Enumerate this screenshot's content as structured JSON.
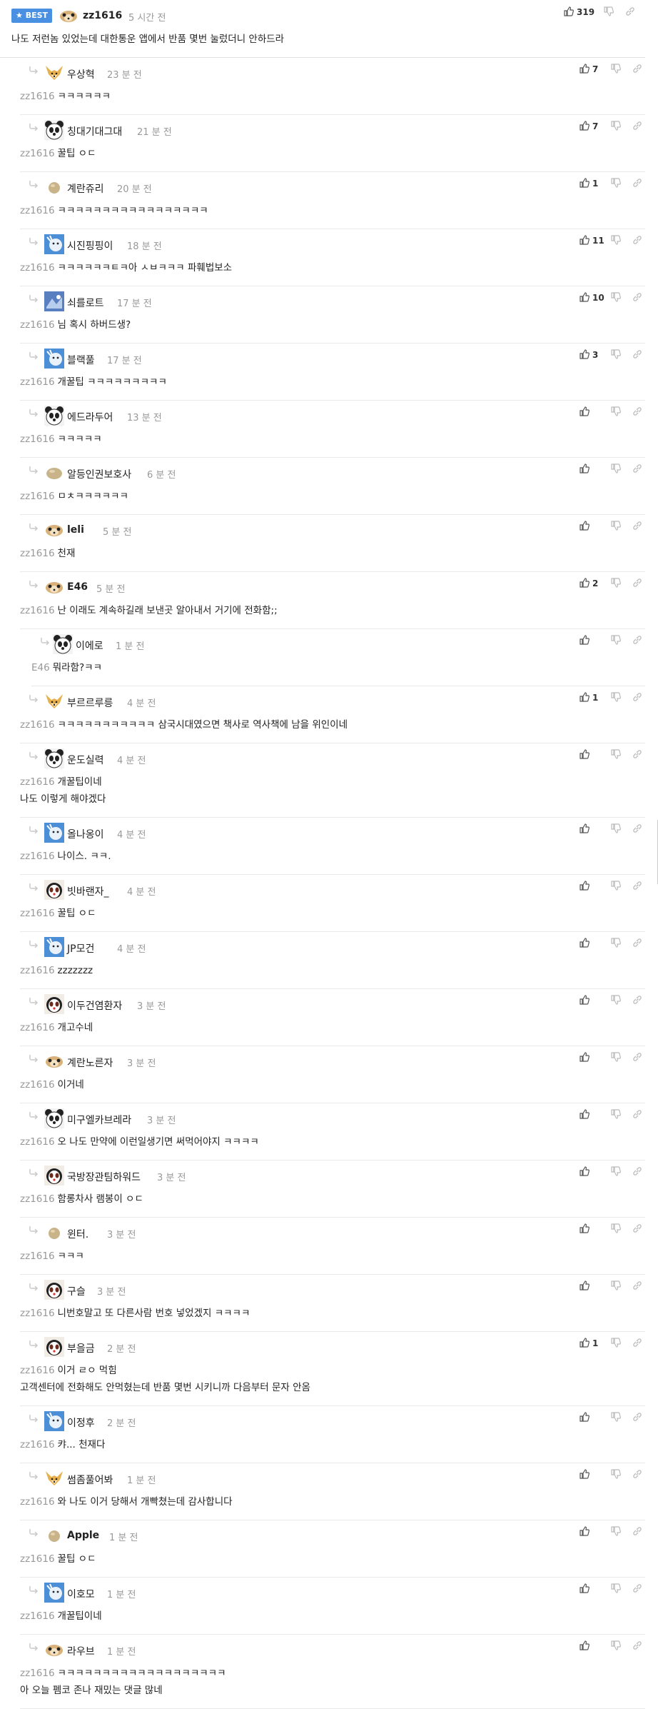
{
  "best": {
    "badge": "★ BEST",
    "nick": "zz1616",
    "time": "5 시간 전",
    "likes": "319",
    "text": "나도 저런놈 있었는데 대한통운 앱에서 반품 몇번 눌렀더니 안하드라"
  },
  "comments": [
    {
      "nick": "우상혁",
      "time": "23 분 전",
      "mention": "zz1616",
      "lines": [
        "ㅋㅋㅋㅋㅋㅋ"
      ],
      "likes": "7",
      "avatar": "fennec"
    },
    {
      "nick": "칭대기대그대",
      "time": "21 분 전",
      "mention": "zz1616",
      "lines": [
        "꿀팁 ㅇㄷ"
      ],
      "likes": "7",
      "avatar": "panda"
    },
    {
      "nick": "계란쥬리",
      "time": "20 분 전",
      "mention": "zz1616",
      "lines": [
        "ㅋㅋㅋㅋㅋㅋㅋㅋㅋㅋㅋㅋㅋㅋㅋㅋㅋ"
      ],
      "likes": "1",
      "avatar": "egg"
    },
    {
      "nick": "시진핑핑이",
      "time": "18 분 전",
      "mention": "zz1616",
      "lines": [
        "ㅋㅋㅋㅋㅋㅋㅌㅋ아 ㅅㅂㅋㅋㅋ 파훼법보소"
      ],
      "likes": "11",
      "avatar": "blue"
    },
    {
      "nick": "쇠를로트",
      "time": "17 분 전",
      "mention": "zz1616",
      "lines": [
        "님 혹시 하버드생?"
      ],
      "likes": "10",
      "avatar": "blue2"
    },
    {
      "nick": "블랙풀",
      "time": "17 분 전",
      "mention": "zz1616",
      "lines": [
        "개꿀팁 ㅋㅋㅋㅋㅋㅋㅋㅋㅋ"
      ],
      "likes": "3",
      "avatar": "blue"
    },
    {
      "nick": "에드라두어",
      "time": "13 분 전",
      "mention": "zz1616",
      "lines": [
        "ㅋㅋㅋㅋㅋ"
      ],
      "likes": "",
      "avatar": "panda"
    },
    {
      "nick": "알등인권보호사",
      "time": "6 분 전",
      "mention": "zz1616",
      "lines": [
        "ㅁㅊㅋㅋㅋㅋㅋㅋ"
      ],
      "likes": "",
      "avatar": "eggbig"
    },
    {
      "nick": "leli",
      "time": "5 분 전",
      "mention": "zz1616",
      "lines": [
        "천재"
      ],
      "likes": "",
      "avatar": "meerkat",
      "bold": true
    },
    {
      "nick": "E46",
      "time": "5 분 전",
      "mention": "zz1616",
      "lines": [
        "난 이래도 계속하길래 보낸곳 알아내서 거기에 전화함;;"
      ],
      "likes": "2",
      "avatar": "meerkat",
      "bold": true
    },
    {
      "nick": "이에로",
      "time": "1 분 전",
      "mention": "E46",
      "lines": [
        "뭐라함?ㅋㅋ"
      ],
      "likes": "",
      "avatar": "panda",
      "child": true
    },
    {
      "nick": "부르르루릉",
      "time": "4 분 전",
      "mention": "zz1616",
      "lines": [
        "ㅋㅋㅋㅋㅋㅋㅋㅋㅋㅋㅋ 삼국시대였으면 책사로 역사책에 남을 위인이네"
      ],
      "likes": "1",
      "avatar": "fennec"
    },
    {
      "nick": "운도실력",
      "time": "4 분 전",
      "mention": "zz1616",
      "lines": [
        "개꿀팁이네",
        "나도 이렇게 해야겠다"
      ],
      "likes": "",
      "avatar": "panda"
    },
    {
      "nick": "올나옹이",
      "time": "4 분 전",
      "mention": "zz1616",
      "lines": [
        "나이스. ㅋㅋ."
      ],
      "likes": "",
      "avatar": "blue"
    },
    {
      "nick": "빗바랜자_",
      "time": "4 분 전",
      "mention": "zz1616",
      "lines": [
        "꿀팁 ㅇㄷ"
      ],
      "likes": "",
      "avatar": "redpanda"
    },
    {
      "nick": "JP모건",
      "time": "4 분 전",
      "mention": "zz1616",
      "lines": [
        "zzzzzzz"
      ],
      "likes": "",
      "avatar": "blue"
    },
    {
      "nick": "이두건염환자",
      "time": "3 분 전",
      "mention": "zz1616",
      "lines": [
        "개고수네"
      ],
      "likes": "",
      "avatar": "redpanda"
    },
    {
      "nick": "계란노른자",
      "time": "3 분 전",
      "mention": "zz1616",
      "lines": [
        "이거네"
      ],
      "likes": "",
      "avatar": "meerkat"
    },
    {
      "nick": "미구엘카브레라",
      "time": "3 분 전",
      "mention": "zz1616",
      "lines": [
        "오 나도 만약에 이런일생기면 써먹어야지 ㅋㅋㅋㅋ"
      ],
      "likes": "",
      "avatar": "panda"
    },
    {
      "nick": "국방장관팀하워드",
      "time": "3 분 전",
      "mention": "zz1616",
      "lines": [
        "함롱차사 램봉이 ㅇㄷ"
      ],
      "likes": "",
      "avatar": "redpanda"
    },
    {
      "nick": "윈터.",
      "time": "3 분 전",
      "mention": "zz1616",
      "lines": [
        "ㅋㅋㅋ"
      ],
      "likes": "",
      "avatar": "egg"
    },
    {
      "nick": "구슬",
      "time": "3 분 전",
      "mention": "zz1616",
      "lines": [
        "니번호말고 또 다른사람 번호 넣었겠지 ㅋㅋㅋㅋ"
      ],
      "likes": "",
      "avatar": "redpanda"
    },
    {
      "nick": "부을금",
      "time": "2 분 전",
      "mention": "zz1616",
      "lines": [
        "이거 ㄹㅇ 먹힘",
        "고객센터에 전화해도 안먹혔는데 반품 몇번 시키니까 다음부터 문자 안옴"
      ],
      "likes": "1",
      "avatar": "redpanda"
    },
    {
      "nick": "이정후",
      "time": "2 분 전",
      "mention": "zz1616",
      "lines": [
        "캬... 천재다"
      ],
      "likes": "",
      "avatar": "blue"
    },
    {
      "nick": "썸좀풀어봐",
      "time": "1 분 전",
      "mention": "zz1616",
      "lines": [
        "와 나도 이거 당해서 개빡쳤는데 감사합니다"
      ],
      "likes": "",
      "avatar": "fennec"
    },
    {
      "nick": "Apple",
      "time": "1 분 전",
      "mention": "zz1616",
      "lines": [
        "꿀팁 ㅇㄷ"
      ],
      "likes": "",
      "avatar": "egg",
      "bold": true
    },
    {
      "nick": "이호모",
      "time": "1 분 전",
      "mention": "zz1616",
      "lines": [
        "개꿀팁이네"
      ],
      "likes": "",
      "avatar": "blue"
    },
    {
      "nick": "라우브",
      "time": "1 분 전",
      "mention": "zz1616",
      "lines": [
        "ㅋㅋㅋㅋㅋㅋㅋㅋㅋㅋㅋㅋㅋㅋㅋㅋㅋㅋㅋ",
        "아 오늘 펨코 존나 재밌는 댓글 많네"
      ],
      "likes": "",
      "avatar": "meerkat"
    }
  ],
  "icons": {
    "like": "thumbs-up-icon",
    "dislike": "thumbs-down-icon",
    "link": "link-icon",
    "reply": "reply-arrow-icon"
  },
  "colors": {
    "badge": "#4a90e2",
    "muted": "#999999",
    "border": "#e9e9e9"
  }
}
